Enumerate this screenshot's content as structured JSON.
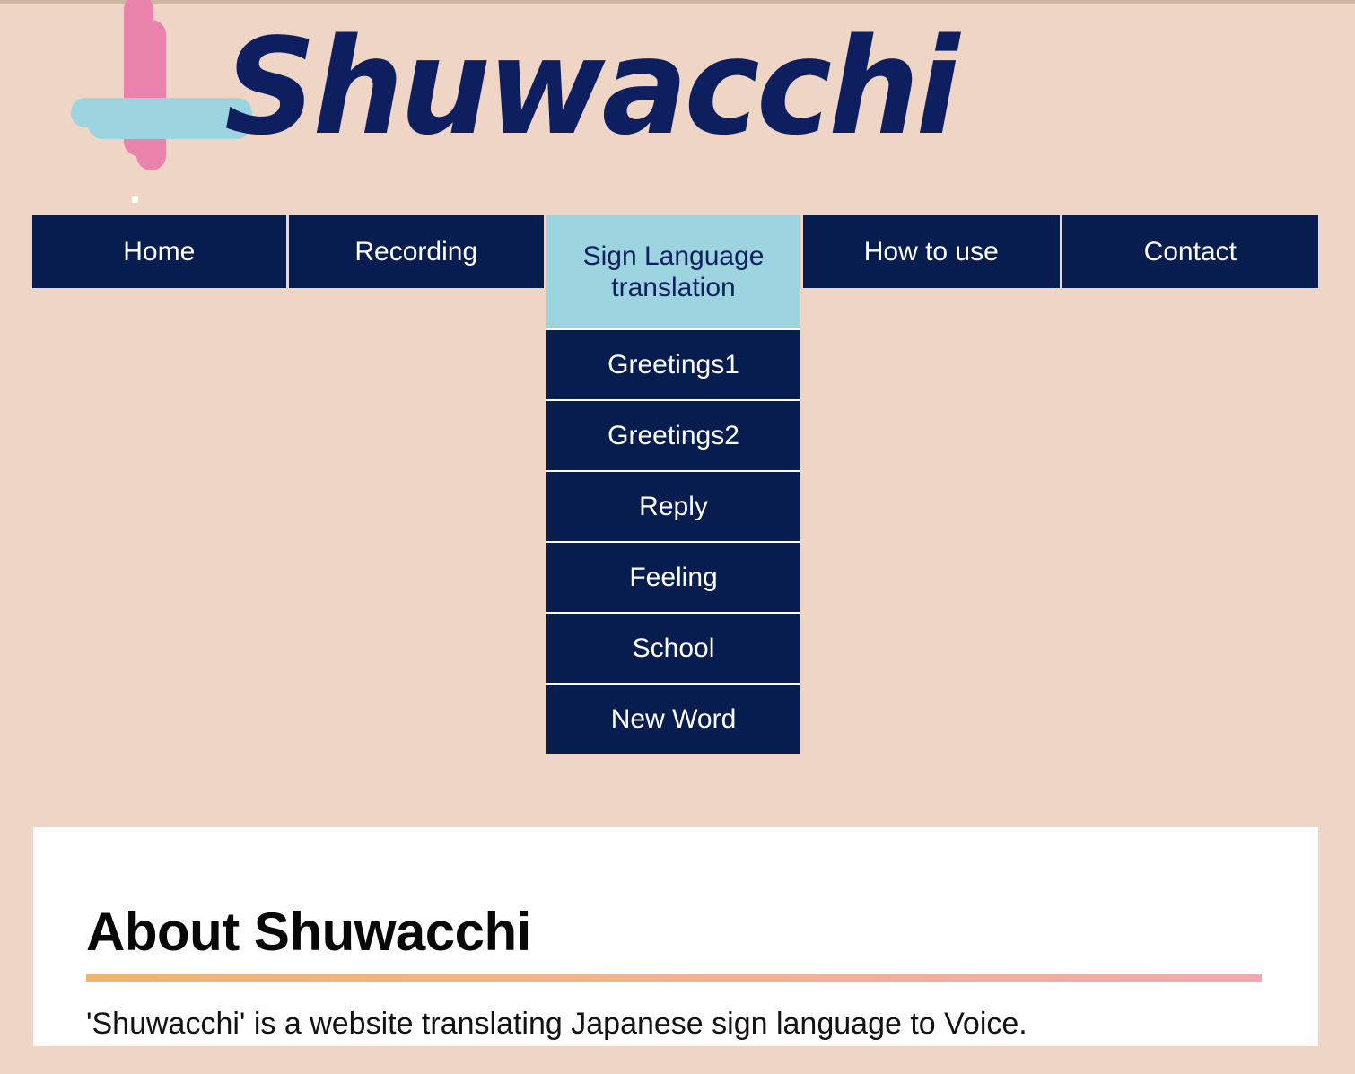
{
  "site": {
    "name": "Shuwacchi",
    "logo_icon": "plus-cross-logo",
    "colors": {
      "background": "#efd5c5",
      "top_strip": "#cdb7a2",
      "navy": "#071d50",
      "wordmark_navy": "#0d1f5e",
      "light_blue": "#9cd4df",
      "pink": "#ea83ac",
      "panel": "#ffffff",
      "rule_gradient_start": "#f2b36f",
      "rule_gradient_end": "#f1a9ad"
    }
  },
  "nav": {
    "home_label": "Home",
    "recording_label": "Recording",
    "menu_label": "Sign Language translation",
    "howto_label": "How to use",
    "contact_label": "Contact",
    "dropdown": [
      {
        "label": "Greetings1"
      },
      {
        "label": "Greetings2"
      },
      {
        "label": "Reply"
      },
      {
        "label": "Feeling"
      },
      {
        "label": "School"
      },
      {
        "label": "New Word"
      }
    ]
  },
  "main": {
    "heading": "About Shuwacchi",
    "paragraph": "'Shuwacchi' is a website translating Japanese sign language to Voice."
  }
}
